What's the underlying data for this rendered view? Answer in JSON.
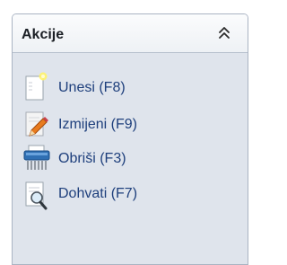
{
  "panel": {
    "title": "Akcije",
    "collapse_icon": "double-chevron-up-icon"
  },
  "actions": [
    {
      "label": "Unesi (F8)",
      "icon": "new-document-icon"
    },
    {
      "label": "Izmijeni (F9)",
      "icon": "edit-pencil-icon"
    },
    {
      "label": "Obriši (F3)",
      "icon": "shredder-delete-icon"
    },
    {
      "label": "Dohvati (F7)",
      "icon": "search-document-icon"
    }
  ],
  "colors": {
    "link_text": "#1e3f7c",
    "panel_bg": "#dfe4ec",
    "panel_border": "#aab4c3"
  }
}
